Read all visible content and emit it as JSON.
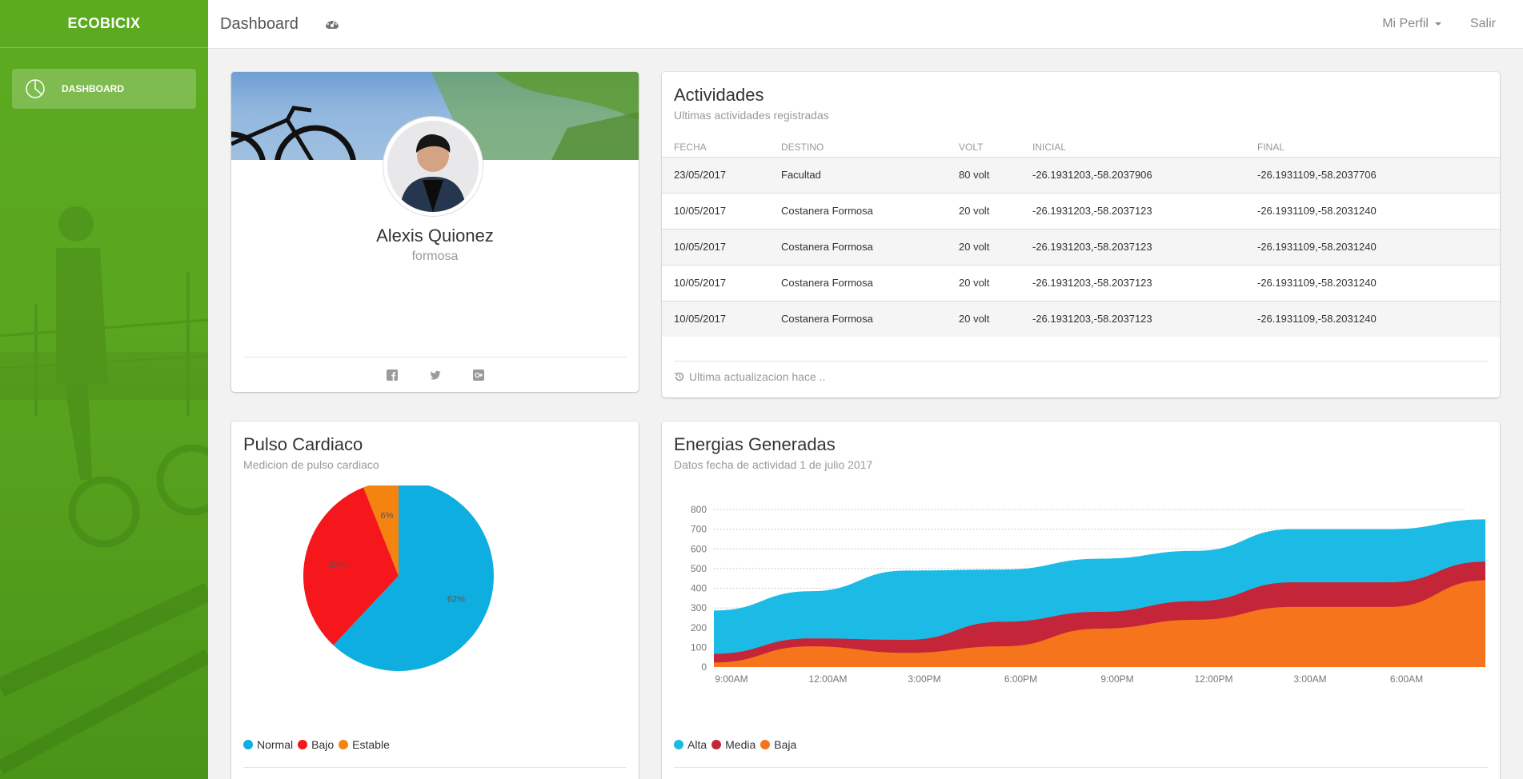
{
  "app": {
    "brand": "ECOBICIX"
  },
  "sidebar": {
    "items": [
      {
        "label": "DASHBOARD",
        "icon": "pie-chart-icon"
      }
    ]
  },
  "navbar": {
    "title": "Dashboard",
    "profile_label": "Mi Perfil",
    "logout_label": "Salir"
  },
  "profile": {
    "name": "Alexis Quionez",
    "location": "formosa",
    "socials": [
      "facebook-icon",
      "twitter-icon",
      "google-plus-icon"
    ]
  },
  "activities": {
    "title": "Actividades",
    "subtitle": "Ultimas actividades registradas",
    "columns": [
      "FECHA",
      "DESTINO",
      "VOLT",
      "INICIAL",
      "FINAL"
    ],
    "rows": [
      [
        "23/05/2017",
        "Facultad",
        "80 volt",
        "-26.1931203,-58.2037906",
        "-26.1931109,-58.2037706"
      ],
      [
        "10/05/2017",
        "Costanera Formosa",
        "20 volt",
        "-26.1931203,-58.2037123",
        "-26.1931109,-58.2031240"
      ],
      [
        "10/05/2017",
        "Costanera Formosa",
        "20 volt",
        "-26.1931203,-58.2037123",
        "-26.1931109,-58.2031240"
      ],
      [
        "10/05/2017",
        "Costanera Formosa",
        "20 volt",
        "-26.1931203,-58.2037123",
        "-26.1931109,-58.2031240"
      ],
      [
        "10/05/2017",
        "Costanera Formosa",
        "20 volt",
        "-26.1931203,-58.2037123",
        "-26.1931109,-58.2031240"
      ]
    ],
    "footer": "Ultima actualizacion hace .."
  },
  "pulse": {
    "title": "Pulso Cardiaco",
    "subtitle": "Medicion de pulso cardiaco"
  },
  "energy": {
    "title": "Energias Generadas",
    "subtitle": "Datos fecha de actividad 1 de julio 2017"
  },
  "chart_data": [
    {
      "type": "pie",
      "slices": [
        {
          "label": "Normal",
          "value": 62,
          "text": "62%",
          "color": "#0eaee0"
        },
        {
          "label": "Bajo",
          "value": 32,
          "text": "32%",
          "color": "#f5171c"
        },
        {
          "label": "Estable",
          "value": 6,
          "text": "6%",
          "color": "#f5830f"
        }
      ]
    },
    {
      "type": "area",
      "categories": [
        "9:00AM",
        "12:00AM",
        "3:00PM",
        "6:00PM",
        "9:00PM",
        "12:00PM",
        "3:00AM",
        "6:00AM",
        ""
      ],
      "ylim": [
        0,
        800
      ],
      "yticks": [
        0,
        100,
        200,
        300,
        400,
        500,
        600,
        700,
        800
      ],
      "grid": true,
      "series": [
        {
          "name": "Alta",
          "color": "#1cbbe6",
          "values": [
            287,
            385,
            490,
            495,
            550,
            590,
            700,
            700,
            750
          ]
        },
        {
          "name": "Media",
          "color": "#c52538",
          "values": [
            67,
            145,
            138,
            230,
            280,
            335,
            430,
            430,
            535
          ]
        },
        {
          "name": "Baja",
          "color": "#f5741c",
          "values": [
            23,
            105,
            72,
            105,
            195,
            240,
            305,
            305,
            440
          ]
        }
      ]
    }
  ]
}
